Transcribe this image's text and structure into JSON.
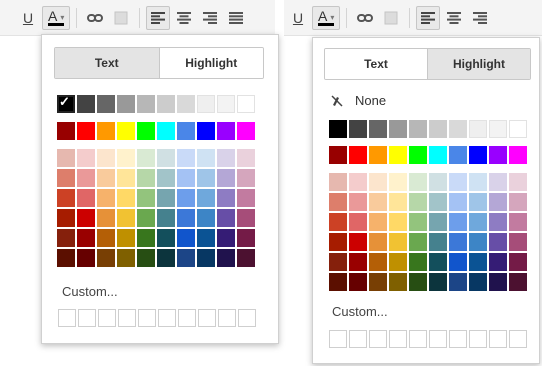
{
  "toolbar_left": {
    "underline_glyph": "U",
    "text_color_glyph": "A",
    "caret_glyph": "▾"
  },
  "toolbar_right": {
    "underline_glyph": "U",
    "text_color_glyph": "A",
    "caret_glyph": "▾"
  },
  "popup_left": {
    "tabs": [
      {
        "label": "Text",
        "selected": true
      },
      {
        "label": "Highlight",
        "selected": false
      }
    ],
    "custom_label": "Custom..."
  },
  "popup_right": {
    "tabs": [
      {
        "label": "Text",
        "selected": false
      },
      {
        "label": "Highlight",
        "selected": true
      }
    ],
    "none_label": "None",
    "custom_label": "Custom..."
  },
  "palette": {
    "grays": [
      "#000000",
      "#434343",
      "#666666",
      "#999999",
      "#b7b7b7",
      "#cccccc",
      "#d9d9d9",
      "#efefef",
      "#f3f3f3",
      "#ffffff"
    ],
    "bright": [
      "#980000",
      "#ff0000",
      "#ff9900",
      "#ffff00",
      "#00ff00",
      "#00ffff",
      "#4a86e8",
      "#0000ff",
      "#9900ff",
      "#ff00ff"
    ],
    "shades": [
      [
        "#e6b8af",
        "#f4cccc",
        "#fce5cd",
        "#fff2cc",
        "#d9ead3",
        "#d0e0e3",
        "#c9daf8",
        "#cfe2f3",
        "#d9d2e9",
        "#ead1dc"
      ],
      [
        "#dd7e6b",
        "#ea9999",
        "#f9cb9c",
        "#ffe599",
        "#b6d7a8",
        "#a2c4c9",
        "#a4c2f4",
        "#9fc5e8",
        "#b4a7d6",
        "#d5a6bd"
      ],
      [
        "#cc4125",
        "#e06666",
        "#f6b26b",
        "#ffd966",
        "#93c47d",
        "#76a5af",
        "#6d9eeb",
        "#6fa8dc",
        "#8e7cc3",
        "#c27ba0"
      ],
      [
        "#a61c00",
        "#cc0000",
        "#e69138",
        "#f1c232",
        "#6aa84f",
        "#45818e",
        "#3c78d8",
        "#3d85c6",
        "#674ea7",
        "#a64d79"
      ],
      [
        "#85200c",
        "#990000",
        "#b45f06",
        "#bf9000",
        "#38761d",
        "#134f5c",
        "#1155cc",
        "#0b5394",
        "#351c75",
        "#741b47"
      ],
      [
        "#5b0f00",
        "#660000",
        "#783f04",
        "#7f6000",
        "#274e13",
        "#0c343d",
        "#1c4587",
        "#073763",
        "#20124d",
        "#4c1130"
      ]
    ]
  },
  "selection": {
    "left_selected_color": "#000000"
  }
}
